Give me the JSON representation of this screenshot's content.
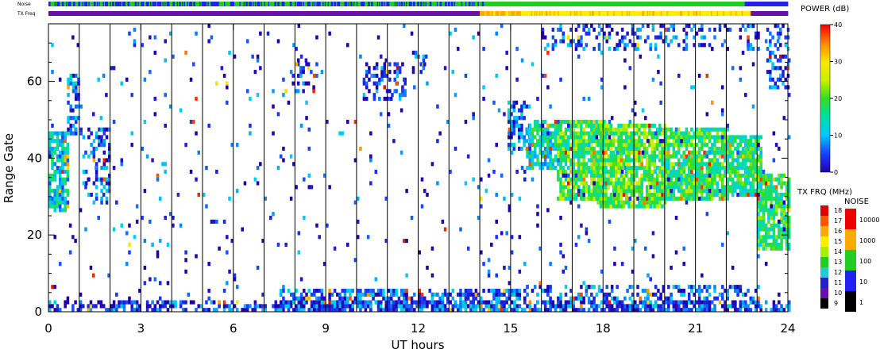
{
  "chart_data": {
    "type": "heatmap",
    "title": "",
    "xlabel": "UT hours",
    "ylabel": "Range Gate",
    "xlim": [
      0,
      24
    ],
    "ylim": [
      0,
      75
    ],
    "x_ticks": [
      0,
      3,
      6,
      9,
      12,
      15,
      18,
      21,
      24
    ],
    "y_ticks": [
      0,
      20,
      40,
      60
    ],
    "scan_boundaries_ut": [
      0,
      1,
      2,
      3,
      4,
      5,
      6,
      7,
      8,
      9,
      10,
      11,
      12,
      13,
      14,
      15,
      16,
      17,
      18,
      19,
      20,
      21,
      22,
      23,
      24
    ],
    "strip_labels": {
      "noise": "Noise",
      "txfreq": "TX Freq"
    },
    "power_colorbar": {
      "title": "POWER (dB)",
      "ticks": [
        "0",
        "10",
        "20",
        "30",
        "40"
      ],
      "range": [
        0,
        40
      ]
    },
    "txfreq_legend": {
      "title": "TX FRQ (MHz)",
      "labels": [
        "9",
        "10",
        "11",
        "12",
        "13",
        "14",
        "15",
        "16",
        "17",
        "18"
      ],
      "colors": [
        "#000000",
        "#6a0fa8",
        "#2222cc",
        "#22cccc",
        "#22cc22",
        "#aaee00",
        "#ffee00",
        "#ffaa00",
        "#ff5500",
        "#dd0000"
      ]
    },
    "noise_legend": {
      "title": "NOISE",
      "labels": [
        "1",
        "10",
        "100",
        "1000",
        "10000"
      ],
      "colors": [
        "#000000",
        "#2222ee",
        "#22cc22",
        "#ffaa00",
        "#ee0000"
      ]
    },
    "noise_strip": [
      {
        "x0": 0,
        "x1": 1.5,
        "level": "mixed"
      },
      {
        "x0": 1.5,
        "x1": 14.2,
        "level": "mixed"
      },
      {
        "x0": 14.2,
        "x1": 22.6,
        "level": "100"
      },
      {
        "x0": 22.6,
        "x1": 24,
        "level": "10"
      }
    ],
    "txfreq_strip": [
      {
        "x0": 0,
        "x1": 14,
        "mhz": 10
      },
      {
        "x0": 14,
        "x1": 15.3,
        "mhz": 16
      },
      {
        "x0": 15.3,
        "x1": 22.8,
        "mhz": 15
      },
      {
        "x0": 22.8,
        "x1": 24,
        "mhz": 10
      }
    ],
    "echo_regions": [
      {
        "x0": 0.0,
        "x1": 0.6,
        "g0": 26,
        "g1": 47,
        "power": 12,
        "density": 0.8
      },
      {
        "x0": 0.6,
        "x1": 1.1,
        "g0": 46,
        "g1": 62,
        "power": 6,
        "density": 0.45
      },
      {
        "x0": 1.1,
        "x1": 2.0,
        "g0": 28,
        "g1": 48,
        "power": 5,
        "density": 0.35
      },
      {
        "x0": 7.9,
        "x1": 8.6,
        "g0": 57,
        "g1": 66,
        "power": 3,
        "density": 0.3
      },
      {
        "x0": 10.2,
        "x1": 11.6,
        "g0": 55,
        "g1": 65,
        "power": 4,
        "density": 0.45
      },
      {
        "x0": 11.8,
        "x1": 12.3,
        "g0": 62,
        "g1": 68,
        "power": 4,
        "density": 0.3
      },
      {
        "x0": 14.9,
        "x1": 15.6,
        "g0": 42,
        "g1": 55,
        "power": 7,
        "density": 0.55
      },
      {
        "x0": 15.5,
        "x1": 16.6,
        "g0": 37,
        "g1": 50,
        "power": 14,
        "density": 0.75
      },
      {
        "x0": 16.5,
        "x1": 18.0,
        "g0": 29,
        "g1": 50,
        "power": 19,
        "density": 0.85
      },
      {
        "x0": 17.8,
        "x1": 20.0,
        "g0": 27,
        "g1": 49,
        "power": 20,
        "density": 0.85
      },
      {
        "x0": 20.0,
        "x1": 22.0,
        "g0": 29,
        "g1": 48,
        "power": 18,
        "density": 0.85
      },
      {
        "x0": 22.0,
        "x1": 23.1,
        "g0": 30,
        "g1": 46,
        "power": 16,
        "density": 0.8
      },
      {
        "x0": 23.0,
        "x1": 24.0,
        "g0": 16,
        "g1": 36,
        "power": 17,
        "density": 0.8
      },
      {
        "x0": 16.0,
        "x1": 23.0,
        "g0": 68,
        "g1": 75,
        "power": 5,
        "density": 0.25
      },
      {
        "x0": 23.3,
        "x1": 24.0,
        "g0": 58,
        "g1": 75,
        "power": 5,
        "density": 0.4
      },
      {
        "x0": 0.0,
        "x1": 24.0,
        "g0": 0,
        "g1": 3,
        "power": 4,
        "density": 0.55
      },
      {
        "x0": 7.5,
        "x1": 15.5,
        "g0": 0,
        "g1": 6,
        "power": 6,
        "density": 0.55
      },
      {
        "x0": 15.5,
        "x1": 23.0,
        "g0": 0,
        "g1": 7,
        "power": 6,
        "density": 0.35
      },
      {
        "x0": 0.0,
        "x1": 24.0,
        "g0": 3,
        "g1": 75,
        "power": 4,
        "density": 0.025
      }
    ]
  }
}
